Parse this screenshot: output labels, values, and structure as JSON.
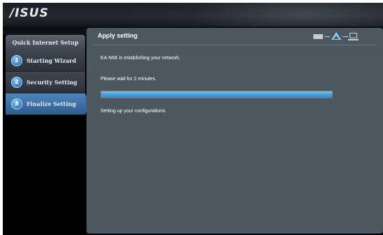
{
  "header": {
    "logo_text": "/ISUS"
  },
  "sidebar": {
    "title": "Quick Internet Setup",
    "items": [
      {
        "number": "1",
        "label": "Starting Wizard",
        "active": false
      },
      {
        "number": "2",
        "label": "Security Setting",
        "active": false
      },
      {
        "number": "3",
        "label": "Finalize Setting",
        "active": true
      }
    ]
  },
  "main": {
    "title": "Apply setting",
    "status_icons": [
      "router-icon",
      "wireless-icon",
      "computer-icon"
    ],
    "line1": "EA-N66 is establishing your network.",
    "line2": "Please wait for 2 minutes.",
    "progress_fraction": 1.0,
    "line3": "Setting up your configurations."
  },
  "colors": {
    "accent": "#4f9bd6",
    "panel_bg": "#4c575f",
    "active_item": "#3f74aa"
  }
}
